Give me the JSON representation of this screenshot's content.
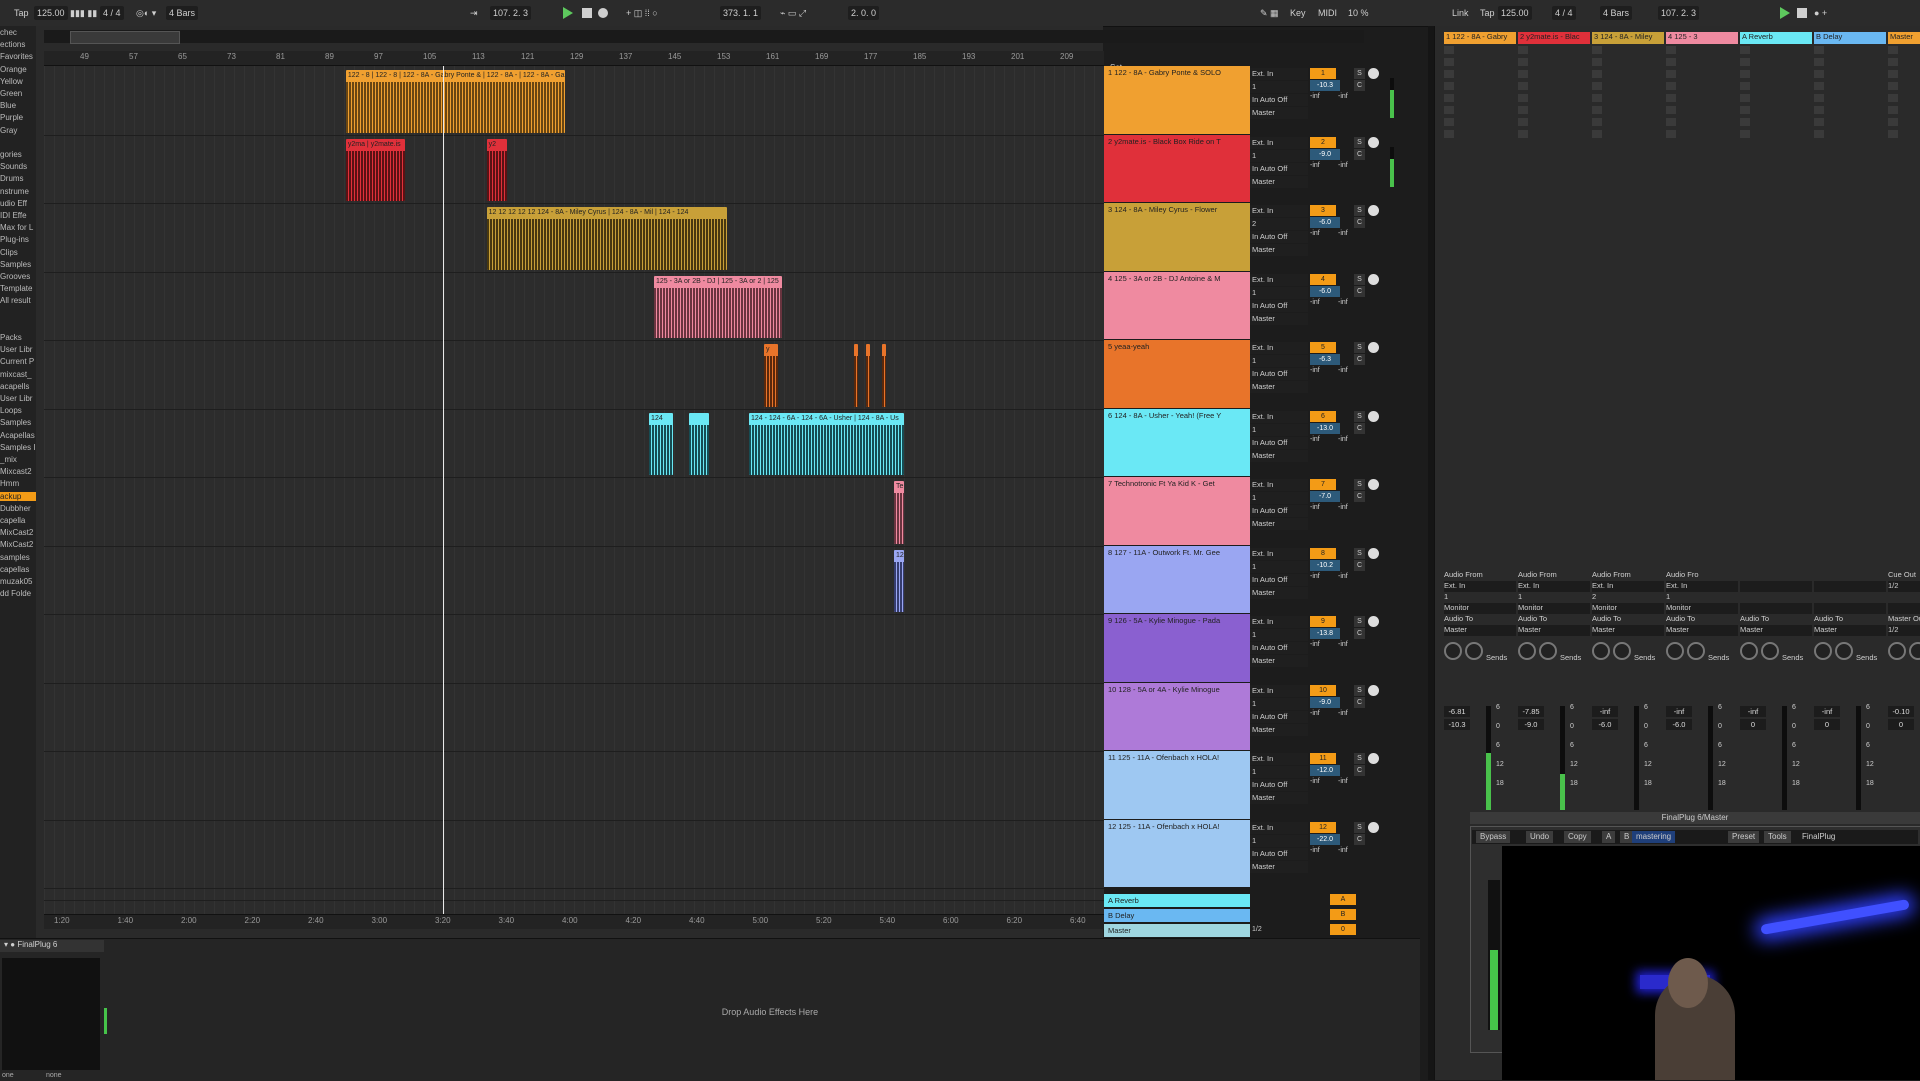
{
  "transport": {
    "tap": "Tap",
    "bpm": "125.00",
    "sig": "4 / 4",
    "quant": "4 Bars",
    "position": "107. 2. 3",
    "loop_start": "373. 1. 1",
    "loop_len": "2. 0. 0",
    "key": "Key",
    "midi": "MIDI",
    "cpu": "10 %"
  },
  "browser": {
    "items": [
      "chec",
      "ections",
      "Favorites",
      "Orange",
      "Yellow",
      "Green",
      "Blue",
      "Purple",
      "Gray",
      "",
      "gories",
      "Sounds",
      "Drums",
      "nstrume",
      "udio Eff",
      "IDI Effe",
      "Max for L",
      "Plug-ins",
      "Clips",
      "Samples",
      "Grooves",
      "Template",
      "All result",
      "",
      "",
      "Packs",
      "User Libr",
      "Current P",
      "mixcast_",
      "acapells",
      "User Libr",
      "Loops",
      "Samples",
      "Acapellas",
      "Samples I",
      "_mix",
      "Mixcast2",
      "Hmm",
      "ackup",
      "Dubbher",
      "capella",
      "MixCast2",
      "MixCast2",
      "samples",
      "capellas",
      "muzak05",
      "dd Folde"
    ]
  },
  "ruler_bars": [
    "49",
    "57",
    "65",
    "73",
    "81",
    "89",
    "97",
    "105",
    "113",
    "121",
    "129",
    "137",
    "145",
    "153",
    "161",
    "169",
    "177",
    "185",
    "193",
    "201",
    "209"
  ],
  "set_label": "Set",
  "time_ticks": [
    "1:20",
    "1:40",
    "2:00",
    "2:20",
    "2:40",
    "3:00",
    "3:20",
    "3:40",
    "4:00",
    "4:20",
    "4:40",
    "5:00",
    "5:20",
    "5:40",
    "6:00",
    "6:20",
    "6:40"
  ],
  "tracks": [
    {
      "name": "1 122 - 8A - Gabry Ponte & SOLO",
      "color": "#f0a030",
      "input": "Ext. In",
      "ch": "1",
      "num": "1",
      "vol": "-10.3",
      "sends": [
        "-inf",
        "-inf"
      ],
      "out": "Master"
    },
    {
      "name": "2 y2mate.is - Black Box Ride on T",
      "color": "#e0303a",
      "input": "Ext. In",
      "ch": "1",
      "num": "2",
      "vol": "-9.0",
      "sends": [
        "-inf",
        "-inf"
      ],
      "out": "Master"
    },
    {
      "name": "3 124 - 8A - Miley Cyrus - Flower",
      "color": "#c8a038",
      "input": "Ext. In",
      "ch": "2",
      "num": "3",
      "vol": "-6.0",
      "sends": [
        "-inf",
        "-inf"
      ],
      "out": "Master"
    },
    {
      "name": "4 125 - 3A or 2B - DJ Antoine & M",
      "color": "#ef8aa0",
      "input": "Ext. In",
      "ch": "1",
      "num": "4",
      "vol": "-6.0",
      "sends": [
        "-inf",
        "-inf"
      ],
      "out": "Master"
    },
    {
      "name": "5 yeaa-yeah",
      "color": "#e8742a",
      "input": "Ext. In",
      "ch": "1",
      "num": "5",
      "vol": "-6.3",
      "sends": [
        "-inf",
        "-inf"
      ],
      "out": "Master"
    },
    {
      "name": "6 124 - 8A - Usher - Yeah! (Free Y",
      "color": "#6ae8f5",
      "input": "Ext. In",
      "ch": "1",
      "num": "6",
      "vol": "-13.0",
      "sends": [
        "-inf",
        "-inf"
      ],
      "out": "Master"
    },
    {
      "name": "7 Technotronic Ft Ya Kid K - Get",
      "color": "#ef8aa0",
      "input": "Ext. In",
      "ch": "1",
      "num": "7",
      "vol": "-7.0",
      "sends": [
        "-inf",
        "-inf"
      ],
      "out": "Master"
    },
    {
      "name": "8 127 - 11A - Outwork Ft. Mr. Gee",
      "color": "#9aa6f2",
      "input": "Ext. In",
      "ch": "1",
      "num": "8",
      "vol": "-10.2",
      "sends": [
        "-inf",
        "-inf"
      ],
      "out": "Master"
    },
    {
      "name": "9 126 - 5A - Kylie Minogue - Pada",
      "color": "#8a60d0",
      "input": "Ext. In",
      "ch": "1",
      "num": "9",
      "vol": "-13.8",
      "sends": [
        "-inf",
        "-inf"
      ],
      "out": "Master"
    },
    {
      "name": "10 128 - 5A or 4A - Kylie Minogue",
      "color": "#ae7ad8",
      "input": "Ext. In",
      "ch": "1",
      "num": "10",
      "vol": "-9.0",
      "sends": [
        "-inf",
        "-inf"
      ],
      "out": "Master"
    },
    {
      "name": "11 125 - 11A - Ofenbach x HOLA!",
      "color": "#9ec8f2",
      "input": "Ext. In",
      "ch": "1",
      "num": "11",
      "vol": "-12.0",
      "sends": [
        "-inf",
        "-inf"
      ],
      "out": "Master"
    },
    {
      "name": "12 125 - 11A - Ofenbach x HOLA!",
      "color": "#9ec8f2",
      "input": "Ext. In",
      "ch": "1",
      "num": "12",
      "vol": "-22.0",
      "sends": [
        "-inf",
        "-inf"
      ],
      "out": "Master"
    }
  ],
  "returns": [
    {
      "name": "A Reverb",
      "color": "#6ae8f5",
      "num": "A"
    },
    {
      "name": "B Delay",
      "color": "#6ab8f2",
      "num": "B"
    },
    {
      "name": "Master",
      "color": "#9fd6e0",
      "num": "0",
      "io": "1/2"
    }
  ],
  "clips": [
    {
      "lane": 0,
      "x": 0.2848,
      "w": 0.2066,
      "label": "122 - 8 | 122 - 8 | 122 - 8A - Gabry Ponte & | 122 - 8A - | 122 - 8A - Ga",
      "color": "#f0a030",
      "dark": "#5a3c10"
    },
    {
      "lane": 1,
      "x": 0.2848,
      "w": 0.0556,
      "label": "y2ma | y2mate.is",
      "color": "#e0303a",
      "dark": "#4a0e10"
    },
    {
      "lane": 1,
      "x": 0.4176,
      "w": 0.0189,
      "label": "y2",
      "color": "#e0303a",
      "dark": "#4a0e10"
    },
    {
      "lane": 2,
      "x": 0.4176,
      "w": 0.2264,
      "label": "12 12 12 12 12 124 - 8A - Miley Cyrus | 124 - 8A - Mil | 124 - 124",
      "color": "#c8a038",
      "dark": "#3a2c0c"
    },
    {
      "lane": 3,
      "x": 0.5755,
      "w": 0.1208,
      "label": "125 - 3A or 2B - DJ | 125 - 3A or 2 | 125",
      "color": "#ef8aa0",
      "dark": "#5a2a34"
    },
    {
      "lane": 4,
      "x": 0.6792,
      "w": 0.0132,
      "label": "y",
      "color": "#e8742a",
      "dark": "#4a2008"
    },
    {
      "lane": 4,
      "x": 0.7641,
      "w": 0.0038,
      "label": "",
      "color": "#e8742a",
      "dark": "#4a2008"
    },
    {
      "lane": 4,
      "x": 0.7755,
      "w": 0.0038,
      "label": "",
      "color": "#e8742a",
      "dark": "#4a2008"
    },
    {
      "lane": 4,
      "x": 0.7906,
      "w": 0.0038,
      "label": "",
      "color": "#e8742a",
      "dark": "#4a2008"
    },
    {
      "lane": 5,
      "x": 0.5708,
      "w": 0.0226,
      "label": "124",
      "color": "#6ae8f5",
      "dark": "#0e3a40"
    },
    {
      "lane": 5,
      "x": 0.6085,
      "w": 0.0189,
      "label": "",
      "color": "#6ae8f5",
      "dark": "#0e3a40"
    },
    {
      "lane": 5,
      "x": 0.6651,
      "w": 0.1462,
      "label": "124 - 124 - 6A - 124 - 6A - Usher | 124 - 8A - Us",
      "color": "#6ae8f5",
      "dark": "#0e3a40"
    },
    {
      "lane": 6,
      "x": 0.8019,
      "w": 0.0094,
      "label": "Te",
      "color": "#ef8aa0",
      "dark": "#5a2a34"
    },
    {
      "lane": 7,
      "x": 0.8019,
      "w": 0.0094,
      "label": "12",
      "color": "#9aa6f2",
      "dark": "#2a3060"
    }
  ],
  "detail": {
    "device": "FinalPlug 6",
    "drop": "Drop Audio Effects Here",
    "sel1": "one",
    "sel2": "none"
  },
  "session": {
    "link": "Link",
    "tap": "Tap",
    "bpm": "125.00",
    "sig": "4 / 4",
    "quant": "4 Bars",
    "pos": "107. 2. 3",
    "heads": [
      {
        "name": "1 122 - 8A - Gabry",
        "color": "#f0a030"
      },
      {
        "name": "2 y2mate.is - Blac",
        "color": "#e0303a"
      },
      {
        "name": "3 124 - 8A - Miley",
        "color": "#c8a038"
      },
      {
        "name": "4 125 - 3",
        "color": "#ef8aa0"
      },
      {
        "name": "A Reverb",
        "color": "#6ae8f5"
      },
      {
        "name": "B Delay",
        "color": "#6ab8f2"
      },
      {
        "name": "Master",
        "color": "#f0a030"
      }
    ],
    "strips": [
      {
        "from": "Audio From",
        "src": "Ext. In",
        "ch": "1",
        "mon": "Monitor",
        "to": "Audio To",
        "dst": "Master",
        "vol": "-6.81",
        "peak": "-10.3",
        "level": 0.55
      },
      {
        "from": "Audio From",
        "src": "Ext. In",
        "ch": "1",
        "mon": "Monitor",
        "to": "Audio To",
        "dst": "Master",
        "vol": "-7.85",
        "peak": "-9.0",
        "level": 0.35
      },
      {
        "from": "Audio From",
        "src": "Ext. In",
        "ch": "2",
        "mon": "Monitor",
        "to": "Audio To",
        "dst": "Master",
        "vol": "-inf",
        "peak": "-6.0",
        "level": 0
      },
      {
        "from": "Audio Fro",
        "src": "Ext. In",
        "ch": "1",
        "mon": "Monitor",
        "to": "Audio To",
        "dst": "Master",
        "vol": "-inf",
        "peak": "-6.0",
        "level": 0
      },
      {
        "from": "",
        "src": "",
        "ch": "",
        "mon": "",
        "to": "Audio To",
        "dst": "Master",
        "vol": "-inf",
        "peak": "0",
        "level": 0
      },
      {
        "from": "",
        "src": "",
        "ch": "",
        "mon": "",
        "to": "Audio To",
        "dst": "Master",
        "vol": "-inf",
        "peak": "0",
        "level": 0
      },
      {
        "from": "Cue Out",
        "src": "1/2",
        "ch": "",
        "mon": "",
        "to": "Master Out",
        "dst": "1/2",
        "vol": "-0.10",
        "peak": "0",
        "level": 0.4
      }
    ],
    "sends_label": "Sends",
    "scale": [
      "6",
      "0",
      "6",
      "12",
      "18"
    ]
  },
  "plugin": {
    "title": "FinalPlug 6/Master",
    "buttons": [
      "Bypass",
      "Undo",
      "Copy",
      "A",
      "B"
    ],
    "preset_name": "mastering",
    "preset": "Preset",
    "tools": "Tools",
    "brand": "FinalPlug"
  },
  "colors": {
    "accent": "#f39b16",
    "play": "#5ec95e"
  }
}
